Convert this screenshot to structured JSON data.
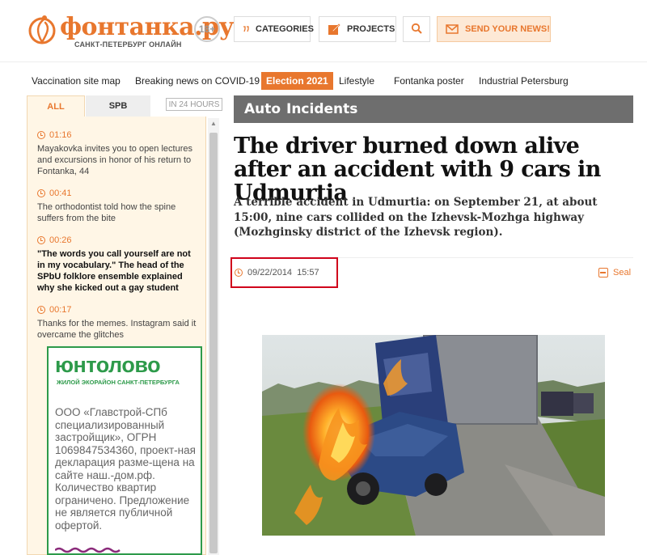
{
  "header": {
    "logo_title": "фонтанка.ру",
    "logo_subtitle": "САНКТ-ПЕТЕРБУРГ ОНЛАЙН",
    "age_badge": "18+",
    "categories_label": "CATEGORIES",
    "projects_label": "PROJECTS",
    "send_news_label": "SEND YOUR NEWS!"
  },
  "nav": {
    "items": [
      {
        "label": "Vaccination site map"
      },
      {
        "label": "Breaking news on COVID-19"
      },
      {
        "label": "Election 2021"
      },
      {
        "label": "Lifestyle"
      },
      {
        "label": "Fontanka poster"
      },
      {
        "label": "Industrial Petersburg"
      }
    ],
    "active_index": 2
  },
  "sidebar": {
    "tabs": [
      {
        "label": "ALL"
      },
      {
        "label": "SPB"
      }
    ],
    "range_label": "IN 24 HOURS",
    "news": [
      {
        "time": "01:16",
        "text": "Mayakovka invites you to open lectures and excursions in honor of his return to Fontanka, 44",
        "bold": false
      },
      {
        "time": "00:41",
        "text": "The orthodontist told how the spine suffers from the bite",
        "bold": false
      },
      {
        "time": "00:26",
        "text": "\"The words you call yourself are not in my vocabulary.\" The head of the SPbU folklore ensemble explained why she kicked out a gay student",
        "bold": true
      },
      {
        "time": "00:17",
        "text": "Thanks for the memes. Instagram said it overcame the glitches",
        "bold": false
      }
    ]
  },
  "ad": {
    "brand": "юнтолово",
    "tagline": "ЖИЛОЙ ЭКОРАЙОН САНКТ-ПЕТЕРБУРГА",
    "text": "ООО «Главстрой-СПб специализированный застройщик», ОГРН 1069847534360, проект-ная декларация разме-щена на сайте наш.-дом.рф. Количество квартир ограничено. Предложение не является публичной офертой."
  },
  "article": {
    "rubrics": [
      "Auto",
      "Incidents"
    ],
    "headline": "The driver burned down alive after an accident with 9 cars in Udmurtia",
    "lead": "A terrible accident in Udmurtia: on September 21, at about 15:00, nine cars collided on the Izhevsk-Mozhga highway (Mozhginsky district of the Izhevsk region).",
    "date": "09/22/2014",
    "time": "15:57",
    "seal_label": "Seal"
  },
  "colors": {
    "accent": "#e8772e",
    "section_bar": "#6e6e6e",
    "highlight": "#d0021b",
    "ad_green": "#2d9a4a"
  },
  "icons": [
    "fountain-logo-icon",
    "quote-icon",
    "pencil-icon",
    "search-icon",
    "mail-icon",
    "clock-icon",
    "print-icon"
  ]
}
